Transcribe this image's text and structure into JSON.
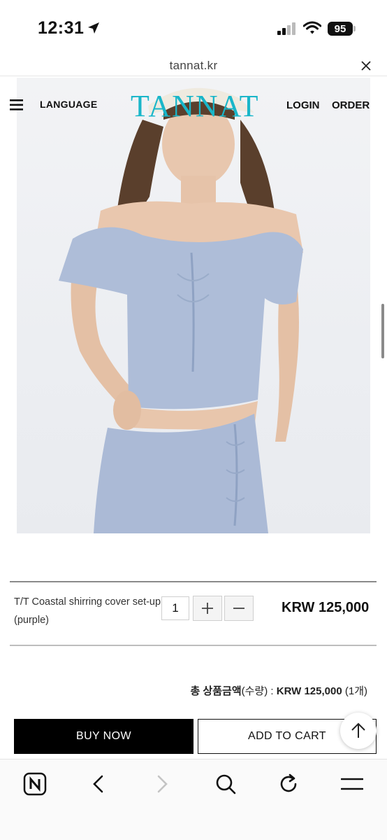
{
  "status_bar": {
    "time": "12:31",
    "battery": "95"
  },
  "browser": {
    "url": "tannat.kr"
  },
  "header": {
    "language": "LANGUAGE",
    "logo": "TANNAT",
    "login": "LOGIN",
    "order": "ORDER"
  },
  "product": {
    "name": "T/T Coastal shirring cover set-up (purple)",
    "quantity": "1",
    "price": "KRW 125,000"
  },
  "total": {
    "label": "총 상품금액",
    "qty_label": "(수량) :",
    "amount": "KRW 125,000",
    "count": "(1개)"
  },
  "buttons": {
    "buy_now": "BUY NOW",
    "add_to_cart": "ADD TO CART"
  },
  "colors": {
    "logo": "#19b6c9",
    "garment": "#aebdd8",
    "primary_button": "#000000"
  }
}
